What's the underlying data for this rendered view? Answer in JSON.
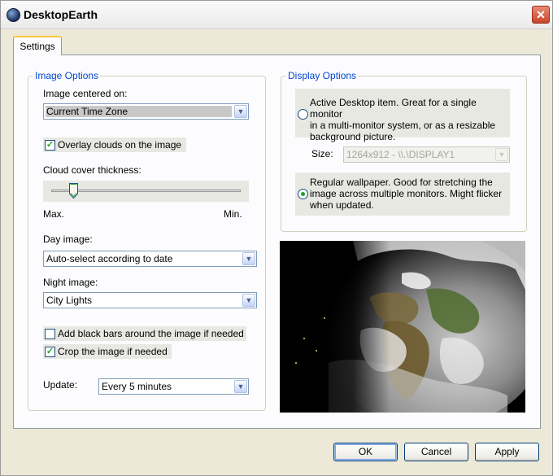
{
  "window": {
    "title": "DesktopEarth",
    "close_glyph": "✕"
  },
  "tabs": [
    {
      "label": "Settings"
    }
  ],
  "image_options": {
    "legend": "Image Options",
    "centered_label": "Image centered on:",
    "centered_value": "Current Time Zone",
    "overlay_clouds": {
      "label": "Overlay clouds on the image",
      "checked": true
    },
    "cloud_thickness_label": "Cloud cover thickness:",
    "cloud_thickness_level": 0.12,
    "cloud_min_max": {
      "max": "Max.",
      "min": "Min."
    },
    "day_image_label": "Day image:",
    "day_image_value": "Auto-select according to date",
    "night_image_label": "Night image:",
    "night_image_value": "City Lights",
    "black_bars": {
      "label": "Add black bars around the image if needed",
      "checked": false
    },
    "crop": {
      "label": "Crop the image if needed",
      "checked": true
    },
    "update_label": "Update:",
    "update_value": "Every 5 minutes"
  },
  "display_options": {
    "legend": "Display Options",
    "active_desktop": {
      "selected": false,
      "lines": [
        "Active Desktop item. Great for a single monitor",
        "in a multi-monitor system, or as a resizable",
        "background picture."
      ]
    },
    "size_label": "Size:",
    "size_value": "1264x912 - \\\\.\\DISPLAY1",
    "regular_wallpaper": {
      "selected": true,
      "lines": [
        "Regular wallpaper. Good for stretching the",
        "image across multiple monitors. Might flicker",
        "when updated."
      ]
    }
  },
  "buttons": {
    "ok": "OK",
    "cancel": "Cancel",
    "apply": "Apply"
  },
  "icons": {
    "app": "earth-icon",
    "close": "close-icon",
    "dropdown": "chevron-down-icon",
    "check": "checkmark-icon"
  },
  "colors": {
    "legend": "#0046d5",
    "check": "#21a121",
    "tab_accent": "#ffc83c",
    "close": "#c8452a"
  }
}
